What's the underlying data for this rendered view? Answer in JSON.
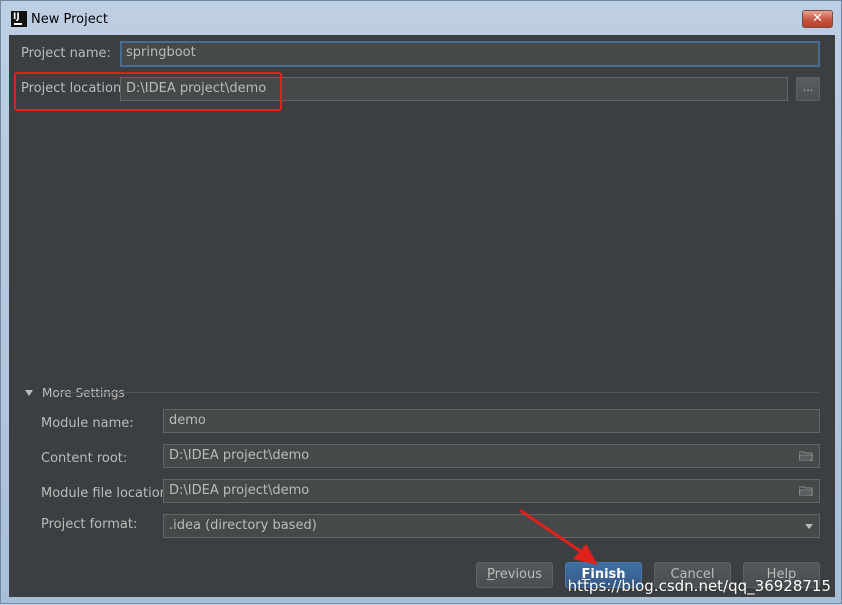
{
  "window": {
    "title": "New Project",
    "app_icon_text": "IJ",
    "close_symbol": "✕",
    "accent_color": "#466d94",
    "highlight_color": "#e0201c"
  },
  "form": {
    "project_name_label": "Project name:",
    "project_name_value": "springboot",
    "project_location_label": "Project location:",
    "project_location_value": "D:\\IDEA project\\demo",
    "browse_label": "..."
  },
  "more_settings": {
    "header": "More Settings",
    "module_name_label": "Module name:",
    "module_name_value": "demo",
    "content_root_label": "Content root:",
    "content_root_value": "D:\\IDEA project\\demo",
    "module_file_location_label": "Module file location:",
    "module_file_location_value": "D:\\IDEA project\\demo",
    "project_format_label": "Project format:",
    "project_format_value": ".idea (directory based)"
  },
  "buttons": {
    "previous_mnemonic": "P",
    "previous_rest": "revious",
    "finish_mnemonic": "F",
    "finish_rest": "inish",
    "cancel": "Cancel",
    "help": "Help"
  },
  "watermark": "https://blog.csdn.net/qq_36928715"
}
